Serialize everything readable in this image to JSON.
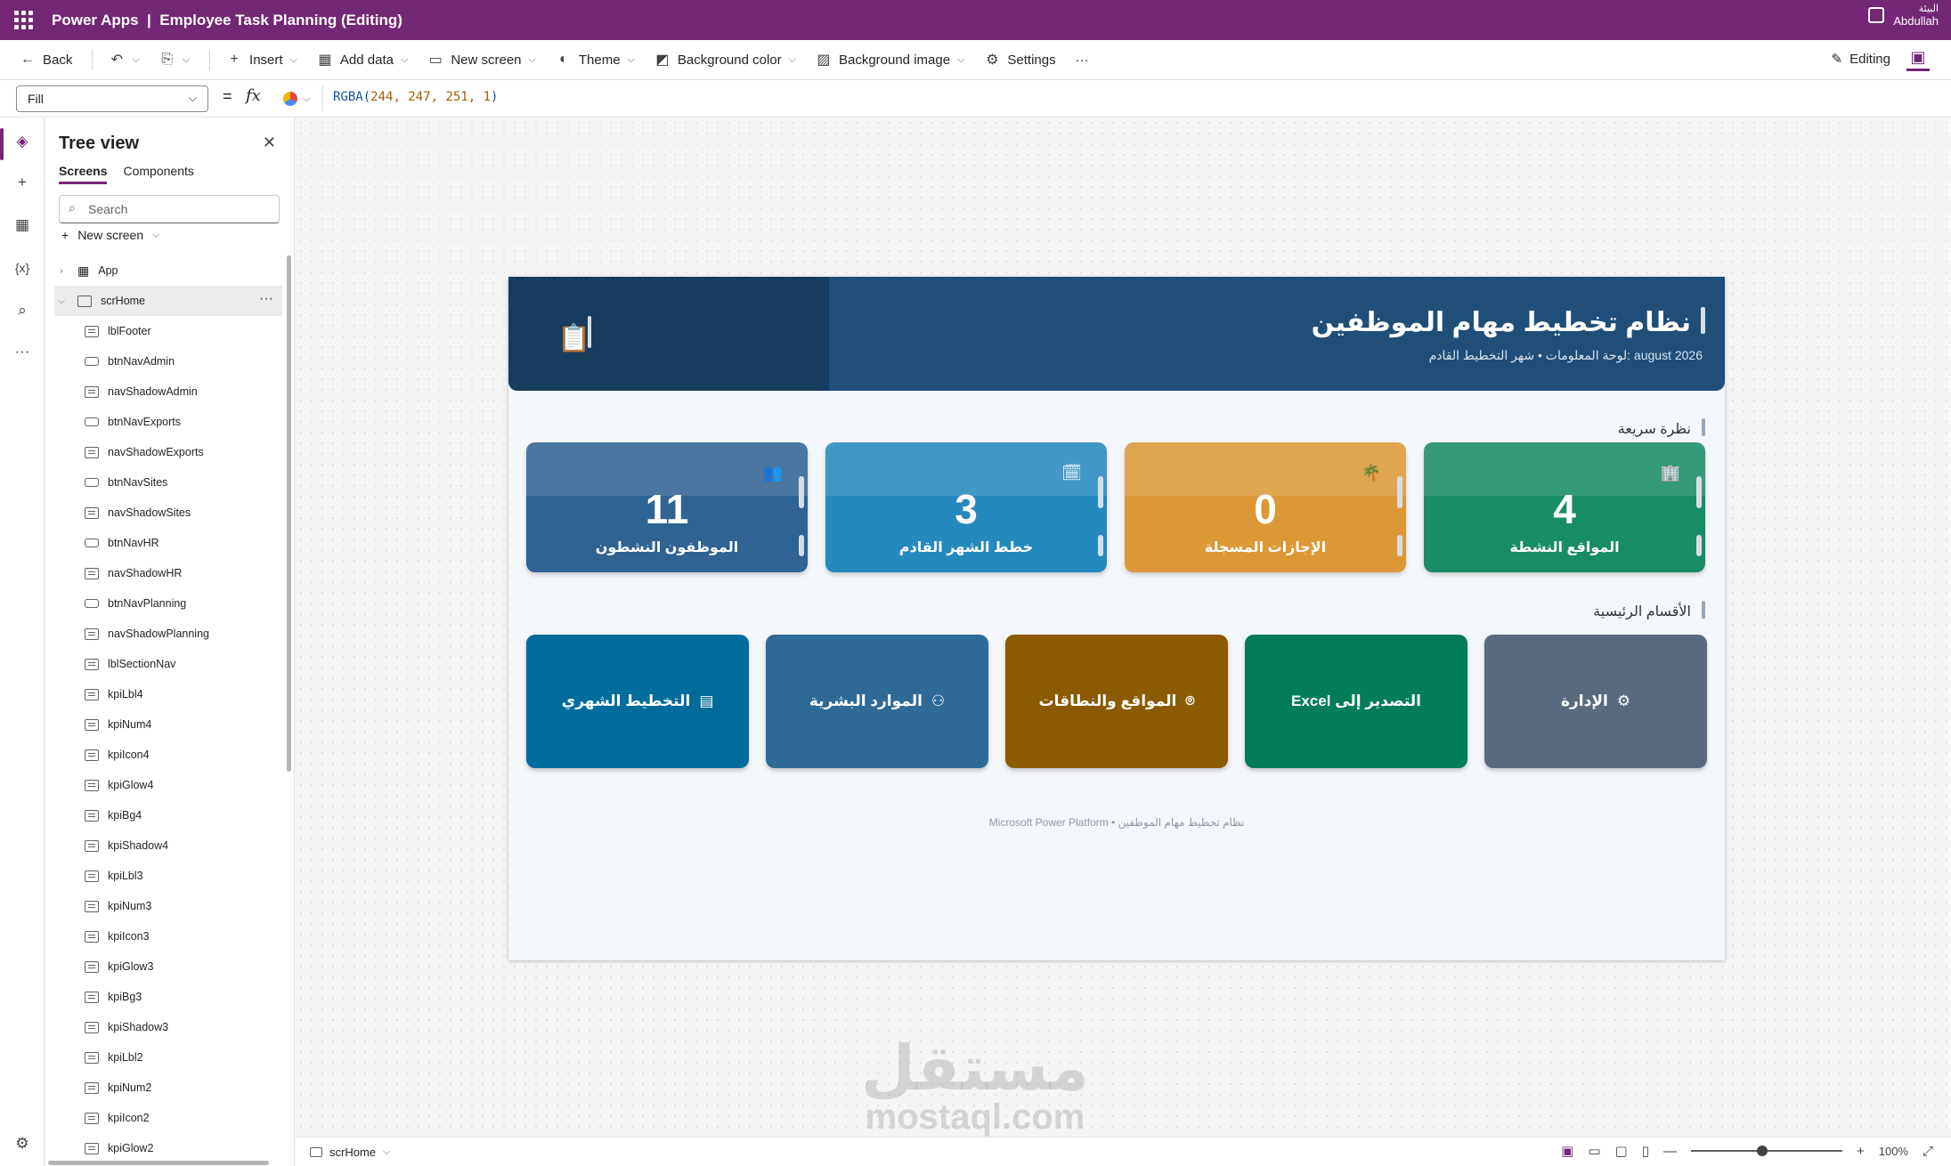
{
  "titlebar": {
    "app_title": "Power Apps  |  Employee Task Planning (Editing)",
    "environment": "البيئة",
    "user": "Abdullah"
  },
  "cmdbar": {
    "back": "Back",
    "insert": "Insert",
    "add_data": "Add data",
    "new_screen": "New screen",
    "theme": "Theme",
    "background_color": "Background color",
    "background_image": "Background image",
    "settings": "Settings",
    "more": "···",
    "editing": "Editing"
  },
  "formula": {
    "property": "Fill",
    "eq": "=",
    "fx": "fx",
    "fn": "RGBA(",
    "args": "244, 247, 251, 1",
    "close": ")"
  },
  "tree": {
    "title": "Tree view",
    "tabs": [
      "Screens",
      "Components"
    ],
    "search_placeholder": "Search",
    "new_screen": "New screen",
    "app": "App",
    "screen": "scrHome",
    "controls": [
      {
        "name": "lblFooter",
        "kind": "lbl"
      },
      {
        "name": "btnNavAdmin",
        "kind": "btn"
      },
      {
        "name": "navShadowAdmin",
        "kind": "lbl"
      },
      {
        "name": "btnNavExports",
        "kind": "btn"
      },
      {
        "name": "navShadowExports",
        "kind": "lbl"
      },
      {
        "name": "btnNavSites",
        "kind": "btn"
      },
      {
        "name": "navShadowSites",
        "kind": "lbl"
      },
      {
        "name": "btnNavHR",
        "kind": "btn"
      },
      {
        "name": "navShadowHR",
        "kind": "lbl"
      },
      {
        "name": "btnNavPlanning",
        "kind": "btn"
      },
      {
        "name": "navShadowPlanning",
        "kind": "lbl"
      },
      {
        "name": "lblSectionNav",
        "kind": "lbl"
      },
      {
        "name": "kpiLbl4",
        "kind": "lbl"
      },
      {
        "name": "kpiNum4",
        "kind": "lbl"
      },
      {
        "name": "kpiIcon4",
        "kind": "lbl"
      },
      {
        "name": "kpiGlow4",
        "kind": "lbl"
      },
      {
        "name": "kpiBg4",
        "kind": "lbl"
      },
      {
        "name": "kpiShadow4",
        "kind": "lbl"
      },
      {
        "name": "kpiLbl3",
        "kind": "lbl"
      },
      {
        "name": "kpiNum3",
        "kind": "lbl"
      },
      {
        "name": "kpiIcon3",
        "kind": "lbl"
      },
      {
        "name": "kpiGlow3",
        "kind": "lbl"
      },
      {
        "name": "kpiBg3",
        "kind": "lbl"
      },
      {
        "name": "kpiShadow3",
        "kind": "lbl"
      },
      {
        "name": "kpiLbl2",
        "kind": "lbl"
      },
      {
        "name": "kpiNum2",
        "kind": "lbl"
      },
      {
        "name": "kpiIcon2",
        "kind": "lbl"
      },
      {
        "name": "kpiGlow2",
        "kind": "lbl"
      }
    ]
  },
  "statusbar": {
    "screen": "scrHome",
    "zoom": "100%",
    "minus": "—",
    "plus": "+"
  },
  "app": {
    "title": "نظام تخطيط مهام الموظفين",
    "subtitle": "august 2026 :لوحة المعلومات  •  شهر التخطيط القادم",
    "banner_icon": "clipboard-icon",
    "section_quick": "نظرة سريعة",
    "section_main": "الأقسام الرئيسية",
    "kpis": [
      {
        "value": "11",
        "label": "الموظفون النشطون",
        "icon": "👥",
        "color": "#2e6393"
      },
      {
        "value": "3",
        "label": "خطط الشهر القادم",
        "icon": "🗓",
        "color": "#2589be"
      },
      {
        "value": "0",
        "label": "الإجازات المسجلة",
        "icon": "🌴",
        "color": "#dc9836"
      },
      {
        "value": "4",
        "label": "المواقع النشطة",
        "icon": "🏢",
        "color": "#188c64"
      }
    ],
    "nav": [
      {
        "label": "التخطيط الشهري",
        "icon": "▤",
        "color": "#006c9c"
      },
      {
        "label": "الموارد البشرية",
        "icon": "⚇",
        "color": "#2e6a98"
      },
      {
        "label": "المواقع والنطاقات",
        "icon": "⌾",
        "color": "#8c5a00"
      },
      {
        "label": "التصدير إلى Excel",
        "icon": "",
        "color": "#037c58"
      },
      {
        "label": "الإدارة",
        "icon": "⚙",
        "color": "#5a6a7e"
      }
    ],
    "footer": "نظام تخطيط مهام الموظفين  •  Microsoft Power Platform"
  },
  "watermark": {
    "ar": "مستقل",
    "en": "mostaql.com"
  }
}
